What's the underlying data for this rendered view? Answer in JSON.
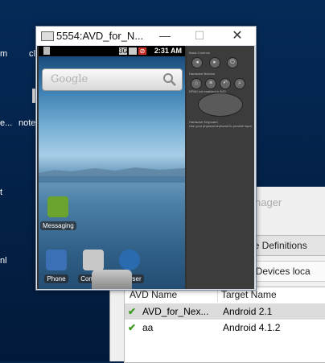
{
  "desktop": {
    "icons": [
      {
        "label": "m"
      },
      {
        "label": "cl"
      },
      {
        "label": "e..."
      },
      {
        "label": "note"
      },
      {
        "label": "t"
      },
      {
        "label": "nl"
      }
    ]
  },
  "avd_manager": {
    "title_fragment": "nager",
    "tab_fragment": "ice Definitions",
    "list_caption_fragment": "al Devices loca",
    "table": {
      "columns": [
        "AVD Name",
        "Target Name"
      ],
      "rows": [
        {
          "name": "AVD_for_Nex...",
          "target": "Android 2.1",
          "selected": true,
          "status": "ok"
        },
        {
          "name": "aa",
          "target": "Android 4.1.2",
          "selected": false,
          "status": "ok"
        }
      ]
    }
  },
  "emulator": {
    "window_title": "5554:AVD_for_N...",
    "window_buttons": {
      "minimize": "—",
      "maximize": "☐",
      "close": "✕"
    },
    "status_bar": {
      "time": "2:31 AM",
      "icons": [
        "3G",
        "signal",
        "no-sim"
      ]
    },
    "search_widget": {
      "placeholder": "Google"
    },
    "apps": [
      {
        "label": "Messaging",
        "icon": "messaging-icon",
        "color": "#6aa32d"
      },
      {
        "label": "Phone",
        "icon": "phone-icon",
        "color": "#3b6fb6"
      },
      {
        "label": "Contacts",
        "icon": "contacts-icon",
        "color": "#c8c8c8"
      },
      {
        "label": "Browser",
        "icon": "browser-icon",
        "color": "#2a6bb0"
      }
    ],
    "controls": {
      "basic_controls": "Basic Controls",
      "hardware_buttons": "Hardware Buttons",
      "dpad": "DPAD not enabled in AVD",
      "keyboard_title": "Hardware Keyboard",
      "keyboard_hint": "Use your physical keyboard to provide input"
    }
  }
}
